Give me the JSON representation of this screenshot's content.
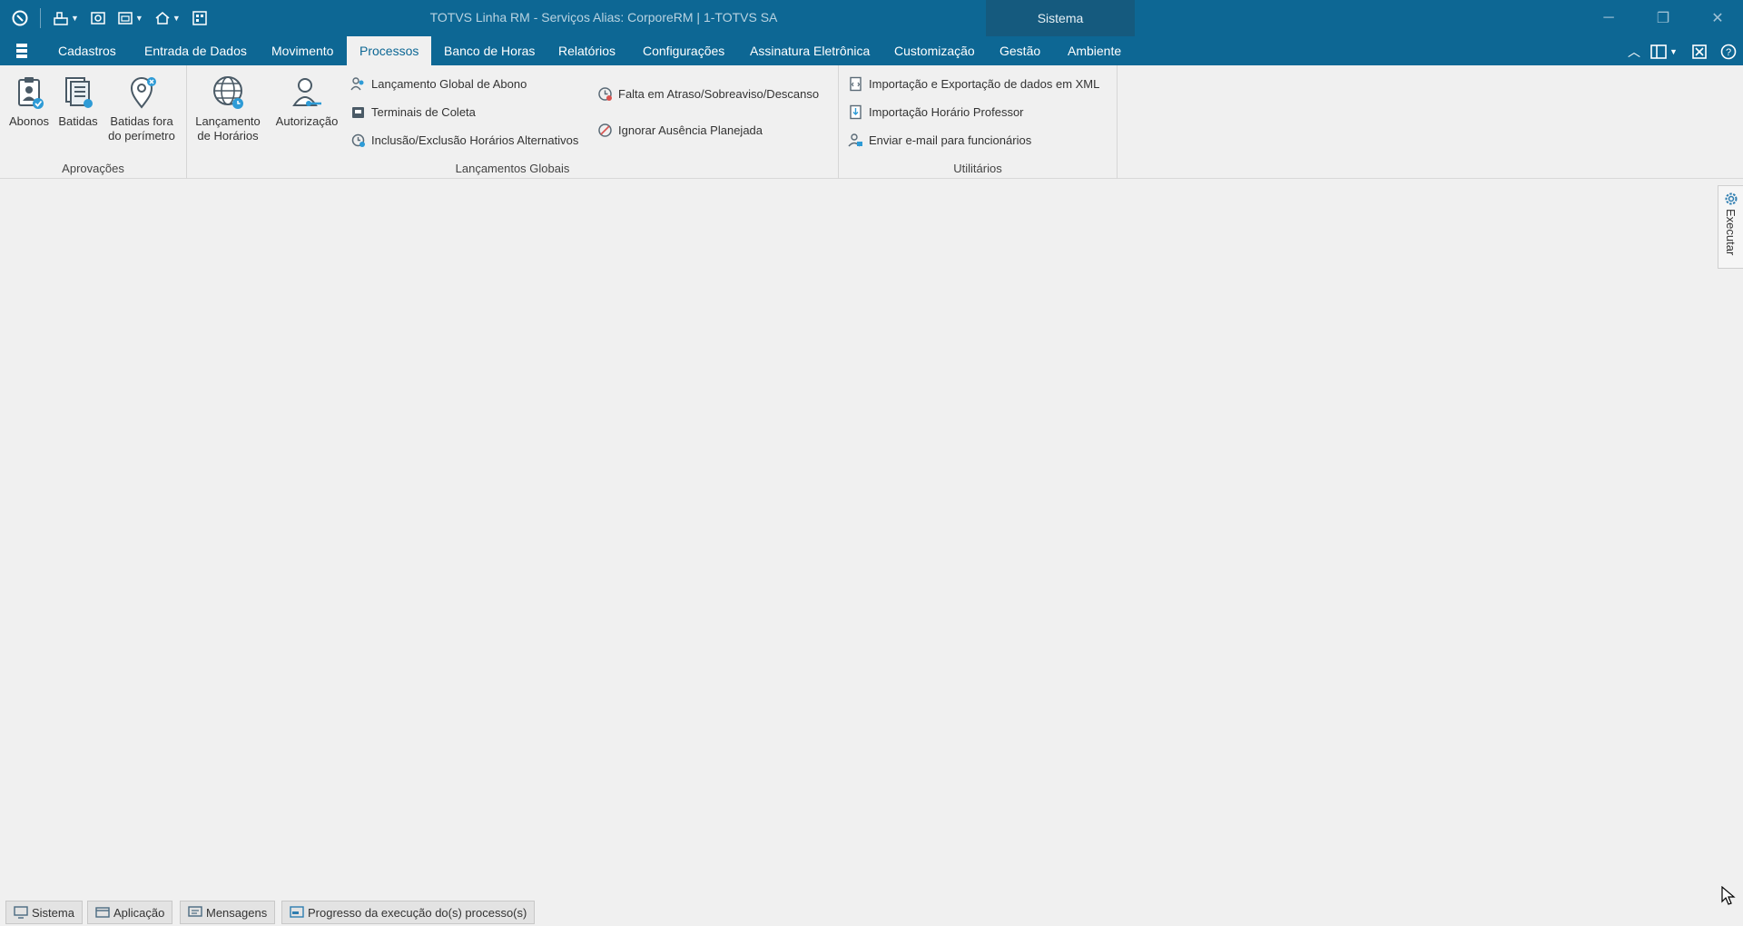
{
  "window": {
    "title": "TOTVS Linha RM - Serviços  Alias: CorporeRM | 1-TOTVS SA",
    "context_tab": "Sistema"
  },
  "quick_access": {
    "icons": [
      "app-logo-icon",
      "tools-icon",
      "view-icon",
      "window-icon",
      "home-icon",
      "grid-icon"
    ]
  },
  "menu": {
    "tabs": [
      "Cadastros",
      "Entrada de Dados",
      "Movimento",
      "Processos",
      "Banco de Horas",
      "Relatórios",
      "Configurações",
      "Assinatura Eletrônica",
      "Customização",
      "Gestão",
      "Ambiente"
    ],
    "active": "Processos"
  },
  "ribbon": {
    "aprovacoes": {
      "label": "Aprovações",
      "abonos": "Abonos",
      "batidas": "Batidas",
      "batidas_fora_1": "Batidas fora",
      "batidas_fora_2": "do perímetro"
    },
    "lancamentos": {
      "label": "Lançamentos Globais",
      "lancamento_horarios_1": "Lançamento",
      "lancamento_horarios_2": "de Horários",
      "autorizacao": "Autorização",
      "global_abono": "Lançamento Global de Abono",
      "terminais": "Terminais de Coleta",
      "inclusao": "Inclusão/Exclusão Horários Alternativos",
      "falta": "Falta em Atraso/Sobreaviso/Descanso",
      "ignorar": "Ignorar Ausência Planejada"
    },
    "utilitarios": {
      "label": "Utilitários",
      "xml": "Importação e Exportação de dados em XML",
      "professor": "Importação Horário Professor",
      "email": "Enviar e-mail para funcionários"
    }
  },
  "side_panel": {
    "label": "Executar"
  },
  "bottom_tabs": [
    "Sistema",
    "Aplicação",
    "Mensagens",
    "Progresso da execução do(s) processo(s)"
  ],
  "colors": {
    "brand": "#0d6794",
    "context_tab": "#155a7e",
    "background": "#f0f0f0"
  }
}
